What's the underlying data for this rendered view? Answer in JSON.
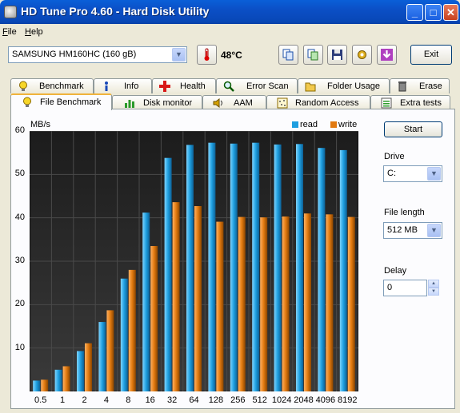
{
  "window": {
    "title": "HD Tune Pro 4.60 - Hard Disk Utility"
  },
  "menu": [
    "File",
    "Help"
  ],
  "toolbar": {
    "drive": "SAMSUNG HM160HC (160 gB)",
    "temperature": "48°C",
    "exit_label": "Exit"
  },
  "tabs_row1": [
    "Benchmark",
    "Info",
    "Health",
    "Error Scan",
    "Folder Usage",
    "Erase"
  ],
  "tabs_row2": [
    "File Benchmark",
    "Disk monitor",
    "AAM",
    "Random Access",
    "Extra tests"
  ],
  "active_tab": "File Benchmark",
  "side": {
    "start_label": "Start",
    "drive_label": "Drive",
    "drive_value": "C:",
    "file_length_label": "File length",
    "file_length_value": "512 MB",
    "delay_label": "Delay",
    "delay_value": "0"
  },
  "chart_data": {
    "type": "bar",
    "ylabel": "MB/s",
    "ylim": [
      0,
      60
    ],
    "yticks": [
      10,
      20,
      30,
      40,
      50,
      60
    ],
    "categories": [
      "0.5",
      "1",
      "2",
      "4",
      "8",
      "16",
      "32",
      "64",
      "128",
      "256",
      "512",
      "1024",
      "2048",
      "4096",
      "8192"
    ],
    "series": [
      {
        "name": "read",
        "color": "#1e9fe0",
        "values": [
          2.5,
          5.0,
          9.3,
          16.0,
          26.0,
          41.2,
          53.8,
          56.8,
          57.3,
          57.1,
          57.3,
          56.9,
          57.0,
          56.1,
          55.6
        ]
      },
      {
        "name": "write",
        "color": "#e27a10",
        "values": [
          2.7,
          5.8,
          11.1,
          18.7,
          28.0,
          33.5,
          43.6,
          42.7,
          39.1,
          40.2,
          40.1,
          40.3,
          41.0,
          40.8,
          40.2
        ]
      }
    ],
    "grid": true,
    "legend": "top-right"
  }
}
